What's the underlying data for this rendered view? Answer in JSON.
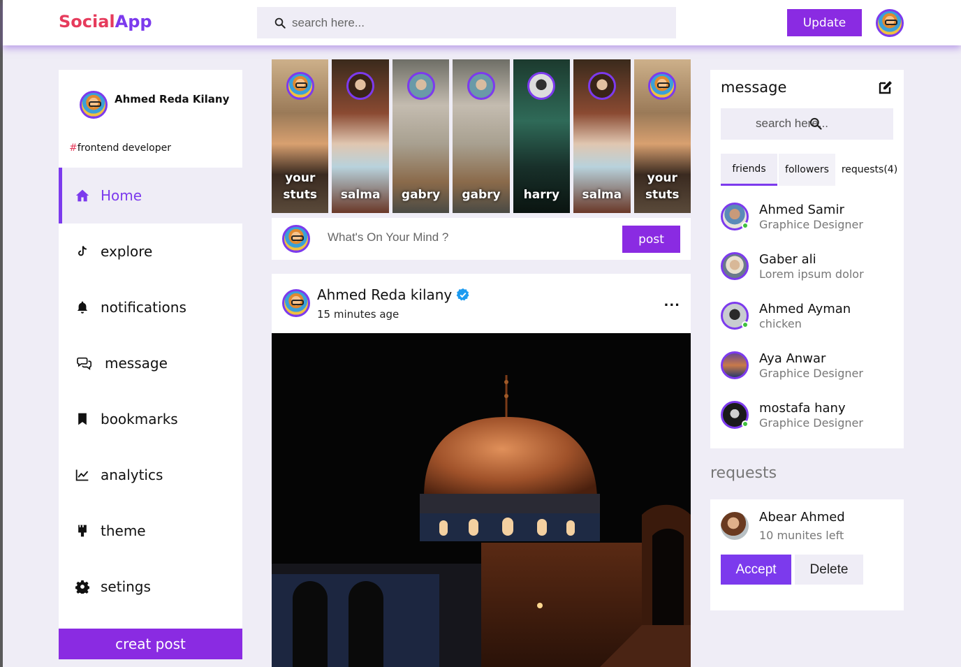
{
  "header": {
    "logo_part1": "Social",
    "logo_part2": "App",
    "search_placeholder": "search here...",
    "update_label": "Update"
  },
  "profile": {
    "name": "Ahmed Reda Kilany",
    "tag_hash": "#",
    "tag_text": "frontend developer"
  },
  "nav": {
    "items": [
      {
        "label": "Home",
        "icon": "home-icon"
      },
      {
        "label": "explore",
        "icon": "tiktok-icon"
      },
      {
        "label": "notifications",
        "icon": "bell-icon"
      },
      {
        "label": "message",
        "icon": "chat-icon"
      },
      {
        "label": "bookmarks",
        "icon": "bookmark-icon"
      },
      {
        "label": "analytics",
        "icon": "chart-line-icon"
      },
      {
        "label": "theme",
        "icon": "brush-icon"
      },
      {
        "label": "setings",
        "icon": "gear-icon"
      }
    ],
    "create_label": "creat post"
  },
  "stories": [
    {
      "line1": "your",
      "line2": "stuts"
    },
    {
      "line1": "",
      "line2": "salma"
    },
    {
      "line1": "",
      "line2": "gabry"
    },
    {
      "line1": "",
      "line2": "gabry"
    },
    {
      "line1": "",
      "line2": "harry"
    },
    {
      "line1": "",
      "line2": "salma"
    },
    {
      "line1": "your",
      "line2": "stuts"
    }
  ],
  "composer": {
    "placeholder": "What's On Your Mind ?",
    "post_label": "post"
  },
  "feed": {
    "author": "Ahmed Reda kilany",
    "time": "15 minutes age",
    "more_label": "..."
  },
  "messages": {
    "title": "message",
    "search_placeholder": "search here...",
    "tabs": [
      "friends",
      "followers",
      "requests(4)"
    ],
    "friends": [
      {
        "name": "Ahmed Samir",
        "sub": "Graphice Designer",
        "online": true
      },
      {
        "name": "Gaber ali",
        "sub": "Lorem ipsum dolor",
        "online": false
      },
      {
        "name": "Ahmed Ayman",
        "sub": "chicken",
        "online": true
      },
      {
        "name": "Aya Anwar",
        "sub": "Graphice Designer",
        "online": false
      },
      {
        "name": "mostafa hany",
        "sub": "Graphice Designer",
        "online": true
      }
    ]
  },
  "requests": {
    "title": "requests",
    "name": "Abear Ahmed",
    "sub": "10 munites left",
    "accept_label": "Accept",
    "delete_label": "Delete"
  },
  "colors": {
    "accent": "#8a2be2",
    "brand_red": "#e63b5c",
    "background": "#efedf6",
    "online": "#40c040"
  }
}
